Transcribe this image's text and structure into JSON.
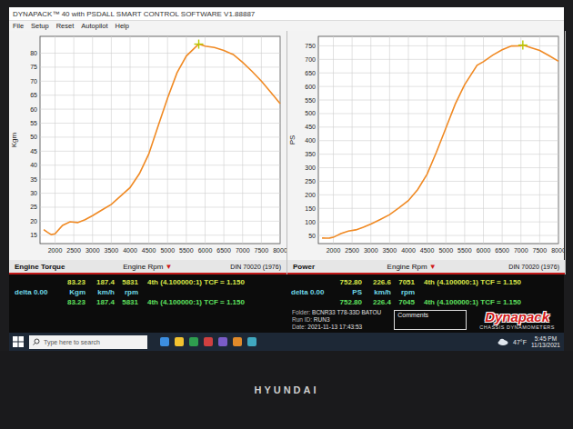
{
  "window": {
    "title": "DYNAPACK™ 40 with PSDALL SMART CONTROL SOFTWARE V1.88887"
  },
  "menu": [
    "File",
    "Setup",
    "Reset",
    "Autopilot",
    "Help"
  ],
  "charts": [
    {
      "title": "Engine Torque",
      "y_label": "Kgm",
      "x_label": "Engine Rpm",
      "x_dropdown": "▼",
      "standard": "DIN 70020 (1976)",
      "y_ticks": [
        "15",
        "20",
        "25",
        "30",
        "35",
        "40",
        "45",
        "50",
        "55",
        "60",
        "65",
        "70",
        "75",
        "80"
      ],
      "x_ticks": [
        "2000",
        "2500",
        "3000",
        "3500",
        "4000",
        "4500",
        "5000",
        "5500",
        "6000",
        "6500",
        "7000",
        "7500",
        "8000"
      ],
      "y_range": [
        12,
        86
      ],
      "x_range": [
        1600,
        8000
      ],
      "series": {
        "color": "#f08a24",
        "rpm": [
          1700,
          1800,
          1900,
          2000,
          2200,
          2400,
          2600,
          2800,
          3000,
          3250,
          3500,
          3750,
          4000,
          4250,
          4500,
          4750,
          5000,
          5250,
          5500,
          5831,
          6000,
          6250,
          6500,
          6750,
          7000,
          7250,
          7500,
          7750,
          8000
        ],
        "values": [
          17,
          16,
          15.2,
          15.5,
          18.5,
          19.8,
          19.5,
          20.5,
          22,
          24,
          26,
          29,
          32,
          37,
          44,
          54,
          64,
          73,
          79,
          83.23,
          82.5,
          82,
          81,
          79.5,
          76.7,
          73.5,
          70,
          66,
          62
        ]
      },
      "peak": {
        "rpm": 5831,
        "value": 83.23
      },
      "readout": [
        {
          "prefix": "",
          "cells": [
            "83.23",
            "187.4",
            "5831"
          ],
          "gear": "4th (4.100000:1) TCF = 1.150",
          "color": "#d8e84a"
        },
        {
          "prefix": "delta 0.00",
          "cells": [
            "Kgm",
            "km/h",
            "rpm"
          ],
          "gear": "",
          "color": "#6fd8e8"
        },
        {
          "prefix": "",
          "cells": [
            "83.23",
            "187.4",
            "5831"
          ],
          "gear": "4th (4.100000:1) TCF = 1.150",
          "color": "#5fe05f"
        }
      ]
    },
    {
      "title": "Power",
      "y_label": "PS",
      "x_label": "Engine Rpm",
      "x_dropdown": "▼",
      "standard": "DIN 70020 (1976)",
      "y_ticks": [
        "50",
        "100",
        "150",
        "200",
        "250",
        "300",
        "350",
        "400",
        "450",
        "500",
        "550",
        "600",
        "650",
        "700",
        "750"
      ],
      "x_ticks": [
        "2000",
        "2500",
        "3000",
        "3500",
        "4000",
        "4500",
        "5000",
        "5500",
        "6000",
        "6500",
        "7000",
        "7500",
        "8000"
      ],
      "y_range": [
        20,
        785
      ],
      "x_range": [
        1600,
        8000
      ],
      "series": {
        "color": "#f08a24",
        "rpm": [
          1700,
          1800,
          1900,
          2000,
          2200,
          2400,
          2600,
          2800,
          3000,
          3250,
          3500,
          3750,
          4000,
          4250,
          4500,
          4750,
          5000,
          5250,
          5500,
          5831,
          6000,
          6250,
          6500,
          6750,
          7000,
          7051,
          7250,
          7500,
          7750,
          8000
        ],
        "values": [
          40.4,
          40.2,
          40.3,
          43.3,
          56.8,
          66.4,
          70.8,
          80.2,
          92.2,
          108.9,
          127.1,
          151.9,
          178.8,
          219.6,
          276.5,
          358.2,
          446.9,
          535.3,
          606.8,
          677.8,
          691.3,
          715.8,
          735.3,
          749.5,
          749.9,
          752.8,
          744,
          733,
          714,
          693
        ]
      },
      "peak": {
        "rpm": 7051,
        "value": 752.8
      },
      "readout": [
        {
          "prefix": "",
          "cells": [
            "752.80",
            "226.6",
            "7051"
          ],
          "gear": "4th (4.100000:1) TCF = 1.150",
          "color": "#d8e84a"
        },
        {
          "prefix": "delta 0.00",
          "cells": [
            "PS",
            "km/h",
            "rpm"
          ],
          "gear": "",
          "color": "#6fd8e8"
        },
        {
          "prefix": "",
          "cells": [
            "752.80",
            "226.4",
            "7045"
          ],
          "gear": "4th (4.100000:1) TCF = 1.150",
          "color": "#5fe05f"
        }
      ]
    }
  ],
  "run_info": {
    "folder_label": "Folder:",
    "folder": "BCNR33 T78-33D BATOU",
    "run_label": "Run ID:",
    "run": "RUN3",
    "date_label": "Date:",
    "date": "2021-11-13 17:43:53"
  },
  "comments": {
    "label": "Comments"
  },
  "logo": {
    "name": "Dynapack",
    "tagline": "CHASSIS DYNAMOMETERS"
  },
  "taskbar": {
    "search_placeholder": "Type here to search",
    "weather": "47°F",
    "time": "5:45 PM",
    "date": "11/13/2021"
  },
  "monitor": {
    "brand": "HYUNDAI"
  }
}
